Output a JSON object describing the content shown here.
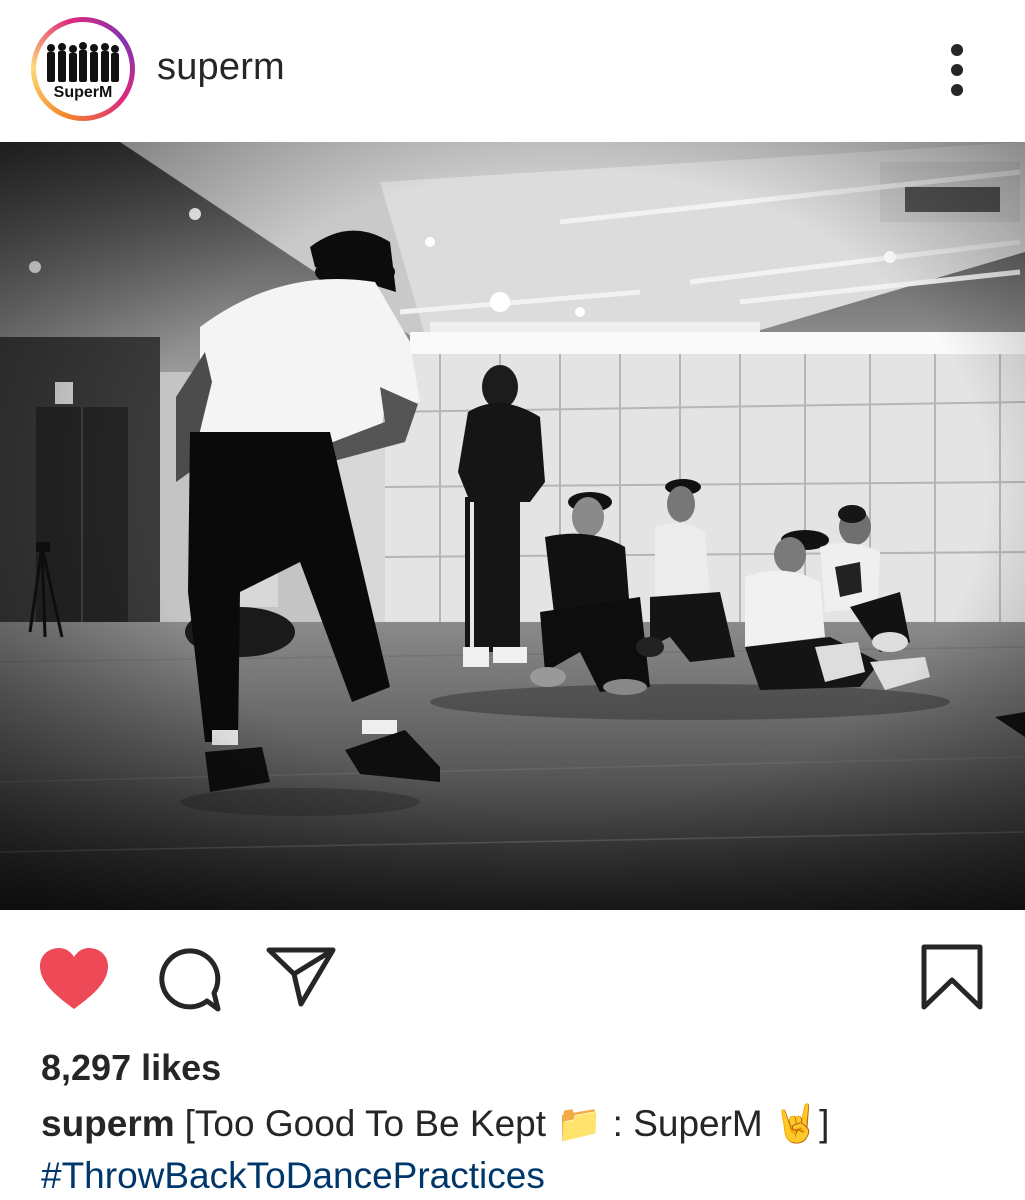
{
  "post": {
    "username": "superm",
    "avatar_label": "SuperM",
    "likes": "8,297 likes",
    "caption_user": "superm",
    "caption_text": "[Too Good To Be Kept 📁 : SuperM 🤘]",
    "hashtag": "#ThrowBackToDancePractices",
    "liked": true
  },
  "icons": {
    "more": "more-options-icon",
    "like": "heart-icon",
    "comment": "comment-icon",
    "share": "send-icon",
    "save": "bookmark-icon"
  },
  "colors": {
    "like_red": "#ed4956",
    "hashtag_blue": "#00376b",
    "text": "#262626"
  }
}
